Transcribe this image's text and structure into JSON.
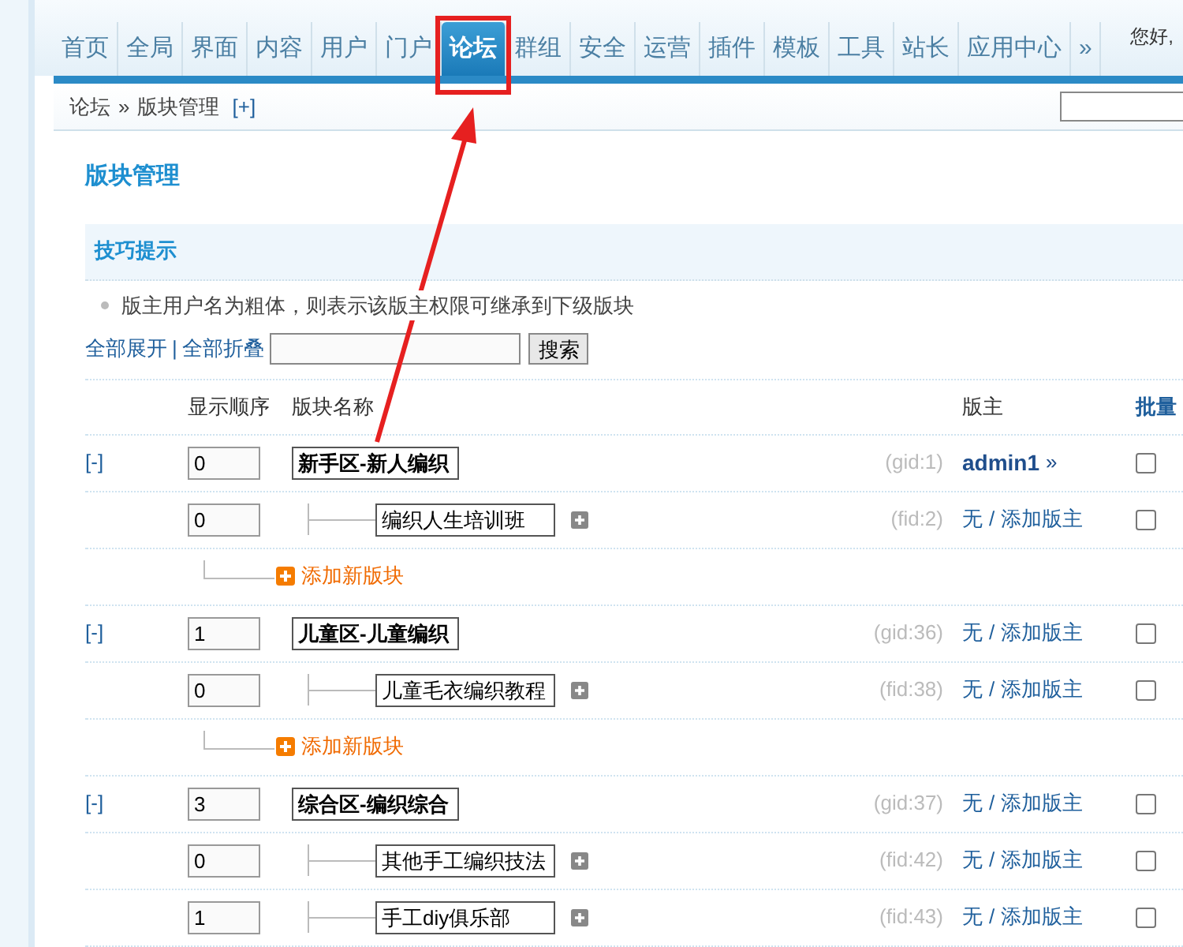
{
  "nav": {
    "tabs": [
      {
        "label": "首页",
        "selected": false
      },
      {
        "label": "全局",
        "selected": false
      },
      {
        "label": "界面",
        "selected": false
      },
      {
        "label": "内容",
        "selected": false
      },
      {
        "label": "用户",
        "selected": false
      },
      {
        "label": "门户",
        "selected": false
      },
      {
        "label": "论坛",
        "selected": true
      },
      {
        "label": "群组",
        "selected": false
      },
      {
        "label": "安全",
        "selected": false
      },
      {
        "label": "运营",
        "selected": false
      },
      {
        "label": "插件",
        "selected": false
      },
      {
        "label": "模板",
        "selected": false
      },
      {
        "label": "工具",
        "selected": false
      },
      {
        "label": "站长",
        "selected": false
      },
      {
        "label": "应用中心",
        "selected": false
      },
      {
        "label": "»",
        "selected": false
      }
    ],
    "greeting": "您好,"
  },
  "breadcrumb": {
    "root": "论坛",
    "sep": "»",
    "current": "版块管理",
    "toggle": "[+]"
  },
  "page_title": "版块管理",
  "tips": {
    "title": "技巧提示",
    "items": [
      "版主用户名为粗体，则表示该版主权限可继承到下级版块"
    ]
  },
  "toolbar": {
    "expand_all": "全部展开",
    "sep": "|",
    "collapse_all": "全部折叠",
    "search_button": "搜索"
  },
  "table": {
    "columns": [
      "显示顺序",
      "版块名称",
      "版主",
      "批量"
    ],
    "groups": [
      {
        "toggle": "[-]",
        "order": "0",
        "name": "新手区-新人编织",
        "id": "(gid:1)",
        "moderator": {
          "kind": "user",
          "name": "admin1",
          "more": "»"
        },
        "checked": false,
        "children": [
          {
            "order": "0",
            "name": "编织人生培训班",
            "id": "(fid:2)",
            "moderator": {
              "kind": "none",
              "none": "无",
              "sep": "/",
              "add": "添加版主"
            },
            "checked": false
          }
        ],
        "add_label": "添加新版块"
      },
      {
        "toggle": "[-]",
        "order": "1",
        "name": "儿童区-儿童编织",
        "id": "(gid:36)",
        "moderator": {
          "kind": "none",
          "none": "无",
          "sep": "/",
          "add": "添加版主"
        },
        "checked": false,
        "children": [
          {
            "order": "0",
            "name": "儿童毛衣编织教程",
            "id": "(fid:38)",
            "moderator": {
              "kind": "none",
              "none": "无",
              "sep": "/",
              "add": "添加版主"
            },
            "checked": false
          }
        ],
        "add_label": "添加新版块"
      },
      {
        "toggle": "[-]",
        "order": "3",
        "name": "综合区-编织综合",
        "id": "(gid:37)",
        "moderator": {
          "kind": "none",
          "none": "无",
          "sep": "/",
          "add": "添加版主"
        },
        "checked": false,
        "children": [
          {
            "order": "0",
            "name": "其他手工编织技法",
            "id": "(fid:42)",
            "moderator": {
              "kind": "none",
              "none": "无",
              "sep": "/",
              "add": "添加版主"
            },
            "checked": false
          },
          {
            "order": "1",
            "name": "手工diy俱乐部",
            "id": "(fid:43)",
            "moderator": {
              "kind": "none",
              "none": "无",
              "sep": "/",
              "add": "添加版主"
            },
            "checked": false
          }
        ]
      }
    ]
  }
}
